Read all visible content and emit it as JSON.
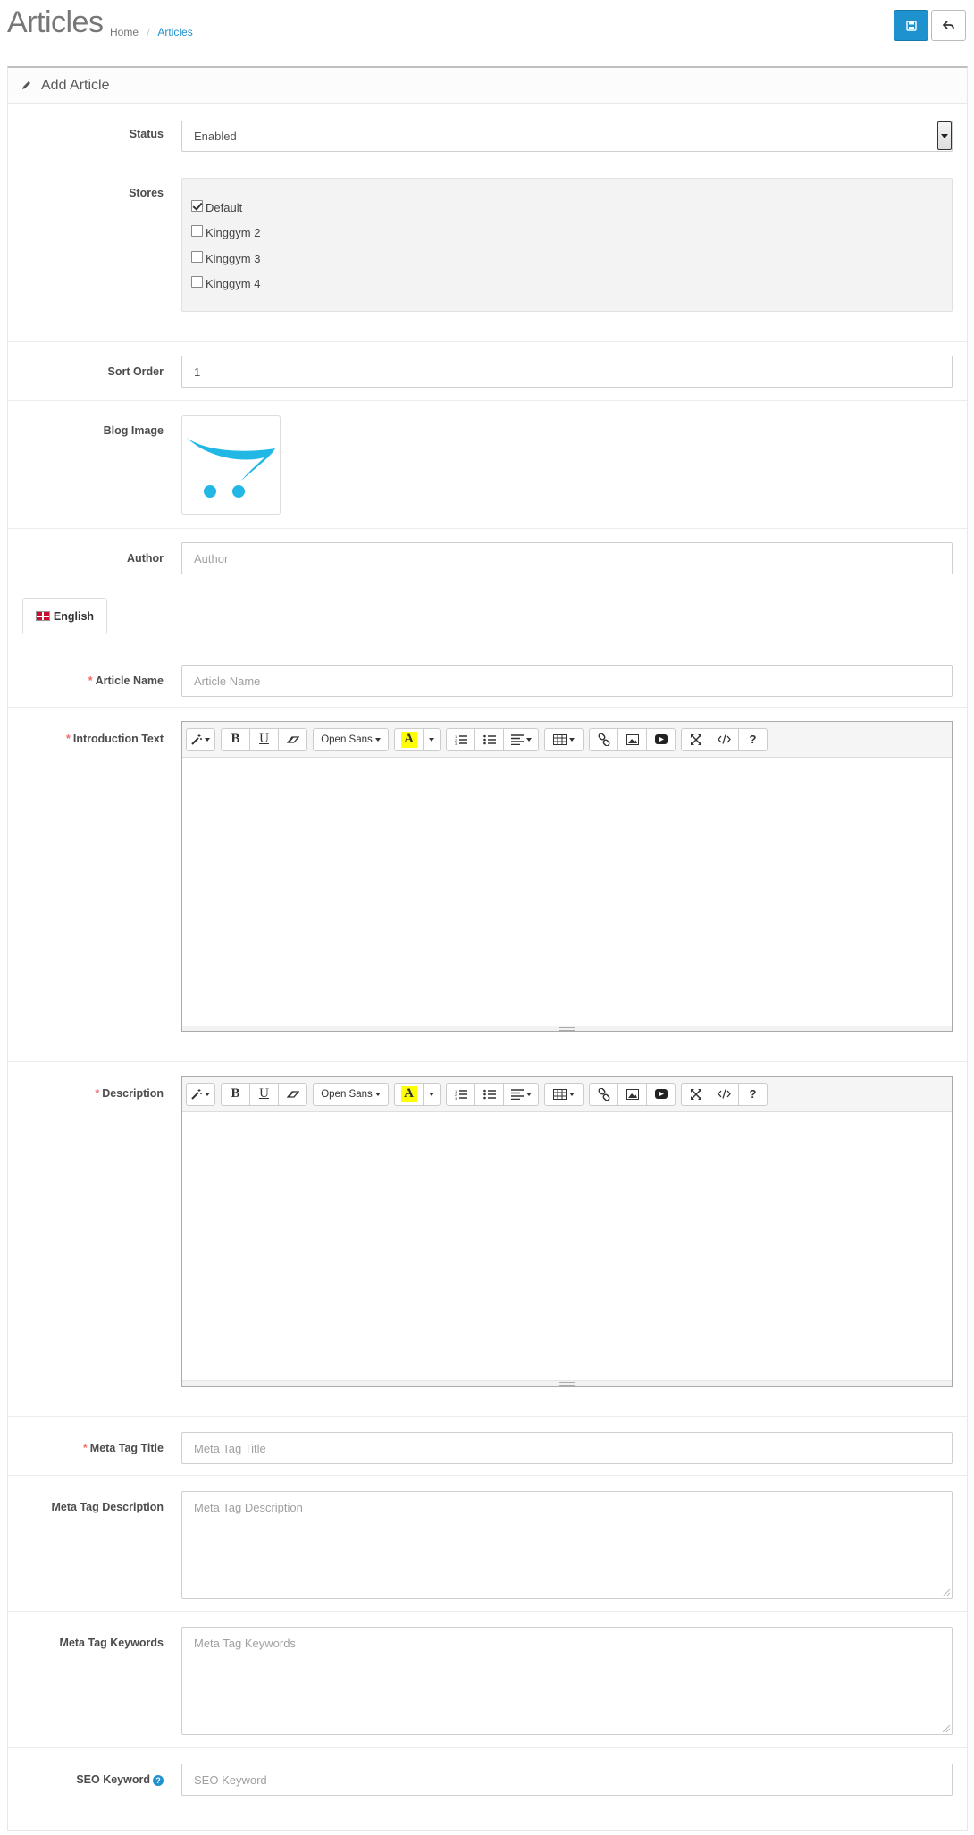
{
  "header": {
    "title": "Articles",
    "breadcrumb": {
      "home": "Home",
      "separator": "/",
      "current": "Articles"
    },
    "save_icon": "save-icon",
    "back_icon": "reply-icon"
  },
  "panel": {
    "title": "Add Article",
    "icon": "pencil-icon"
  },
  "form": {
    "status": {
      "label": "Status",
      "value": "Enabled"
    },
    "stores": {
      "label": "Stores",
      "items": [
        {
          "name": "Default",
          "checked": true
        },
        {
          "name": "Kinggym 2",
          "checked": false
        },
        {
          "name": "Kinggym 3",
          "checked": false
        },
        {
          "name": "Kinggym 4",
          "checked": false
        }
      ]
    },
    "sort_order": {
      "label": "Sort Order",
      "value": "1"
    },
    "blog_image": {
      "label": "Blog Image",
      "image": "opencart-cart-logo"
    },
    "author": {
      "label": "Author",
      "placeholder": "Author"
    },
    "language_tab": {
      "label": "English",
      "icon": "uk-flag-icon"
    },
    "article_name": {
      "label": "Article Name",
      "required": "*",
      "placeholder": "Article Name"
    },
    "introduction_text": {
      "label": "Introduction Text",
      "required": "*"
    },
    "description": {
      "label": "Description",
      "required": "*"
    },
    "meta_title": {
      "label": "Meta Tag Title",
      "required": "*",
      "placeholder": "Meta Tag Title"
    },
    "meta_description": {
      "label": "Meta Tag Description",
      "placeholder": "Meta Tag Description"
    },
    "meta_keywords": {
      "label": "Meta Tag Keywords",
      "placeholder": "Meta Tag Keywords"
    },
    "seo_keyword": {
      "label": "SEO Keyword",
      "placeholder": "SEO Keyword",
      "help": "?"
    }
  },
  "editor_toolbar": {
    "font_name": "Open Sans",
    "bold": "B",
    "underline": "U",
    "color_letter": "A",
    "help": "?"
  },
  "colors": {
    "primary": "#1e91cf",
    "required": "#f56b6b",
    "logo": "#23b7e5"
  }
}
